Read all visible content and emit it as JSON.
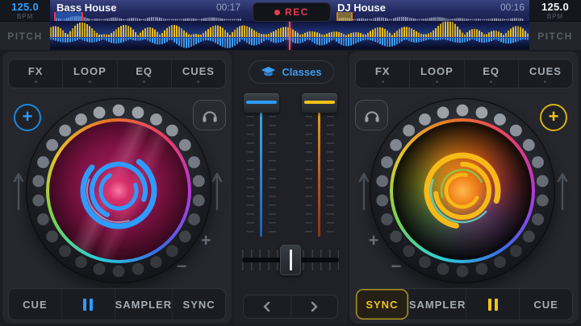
{
  "colors": {
    "accent_blue": "#2f9bff",
    "accent_yellow": "#f2c318",
    "rec_red": "#e63c50"
  },
  "icons": {
    "plus_glyph": "+",
    "minus_glyph": "−"
  },
  "top_bar": {
    "rec_label": "REC",
    "left": {
      "bpm": "125.0",
      "bpm_label": "BPM",
      "pitch_label": "PITCH",
      "track_title": "Bass House",
      "track_time": "00:17"
    },
    "right": {
      "bpm": "125.0",
      "bpm_label": "BPM",
      "pitch_label": "PITCH",
      "track_title": "DJ House",
      "track_time": "00:16"
    }
  },
  "left_deck": {
    "fx_tabs": [
      "FX",
      "LOOP",
      "EQ",
      "CUES"
    ],
    "transport": {
      "cue": "CUE",
      "sampler": "SAMPLER",
      "sync": "SYNC"
    }
  },
  "right_deck": {
    "fx_tabs": [
      "FX",
      "LOOP",
      "EQ",
      "CUES"
    ],
    "transport": {
      "sync": "SYNC",
      "sampler": "SAMPLER",
      "cue": "CUE"
    }
  },
  "mixer": {
    "classes_label": "Classes"
  }
}
